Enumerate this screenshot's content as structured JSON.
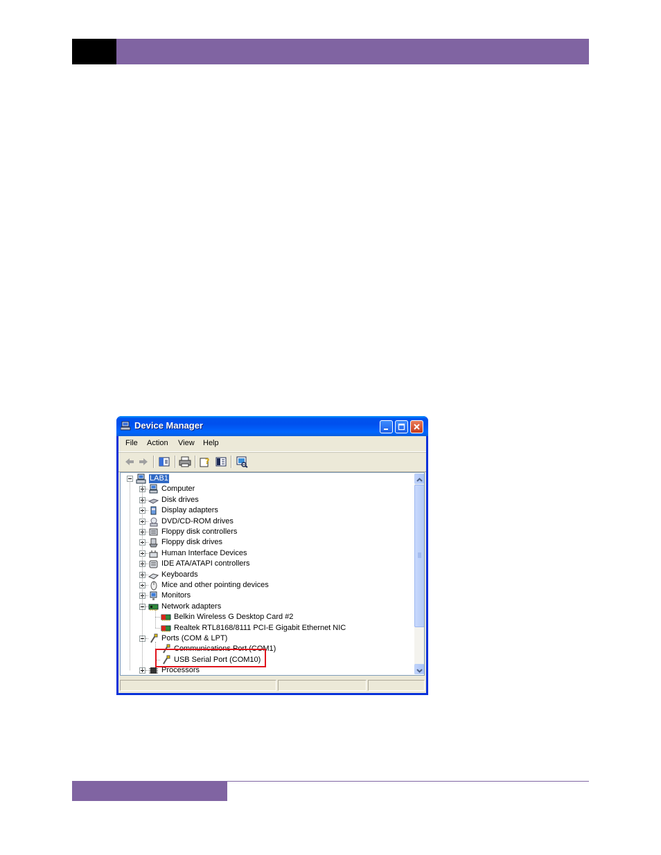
{
  "window": {
    "title": "Device Manager"
  },
  "menu": [
    "File",
    "Action",
    "View",
    "Help"
  ],
  "toolbar_icons": [
    "back-arrow-icon",
    "forward-arrow-icon",
    "show-hide-tree-icon",
    "print-icon",
    "properties-help-icon",
    "update-driver-icon",
    "scan-hardware-icon"
  ],
  "tree": {
    "root": "LAB1",
    "items": [
      {
        "label": "Computer",
        "icon": "computer-icon",
        "expanded": false
      },
      {
        "label": "Disk drives",
        "icon": "disk-drive-icon",
        "expanded": false
      },
      {
        "label": "Display adapters",
        "icon": "display-adapter-icon",
        "expanded": false
      },
      {
        "label": "DVD/CD-ROM drives",
        "icon": "cdrom-icon",
        "expanded": false
      },
      {
        "label": "Floppy disk controllers",
        "icon": "floppy-controller-icon",
        "expanded": false
      },
      {
        "label": "Floppy disk drives",
        "icon": "floppy-drive-icon",
        "expanded": false
      },
      {
        "label": "Human Interface Devices",
        "icon": "hid-icon",
        "expanded": false
      },
      {
        "label": "IDE ATA/ATAPI controllers",
        "icon": "ide-controller-icon",
        "expanded": false
      },
      {
        "label": "Keyboards",
        "icon": "keyboard-icon",
        "expanded": false
      },
      {
        "label": "Mice and other pointing devices",
        "icon": "mouse-icon",
        "expanded": false
      },
      {
        "label": "Monitors",
        "icon": "monitor-icon",
        "expanded": false
      },
      {
        "label": "Network adapters",
        "icon": "network-adapter-icon",
        "expanded": true,
        "children": [
          "Belkin Wireless G Desktop Card #2",
          "Realtek RTL8168/8111 PCI-E Gigabit Ethernet NIC"
        ]
      },
      {
        "label": "Ports (COM & LPT)",
        "icon": "port-icon",
        "expanded": true,
        "children": [
          "Communications Port (COM1)",
          "USB Serial Port (COM10)"
        ]
      },
      {
        "label": "Processors",
        "icon": "processor-icon",
        "expanded": false
      }
    ]
  },
  "colors": {
    "header_accent": "#8064a2",
    "titlebar": "#0053ee",
    "selection": "#316ac5",
    "highlight_box": "#e0141c"
  }
}
